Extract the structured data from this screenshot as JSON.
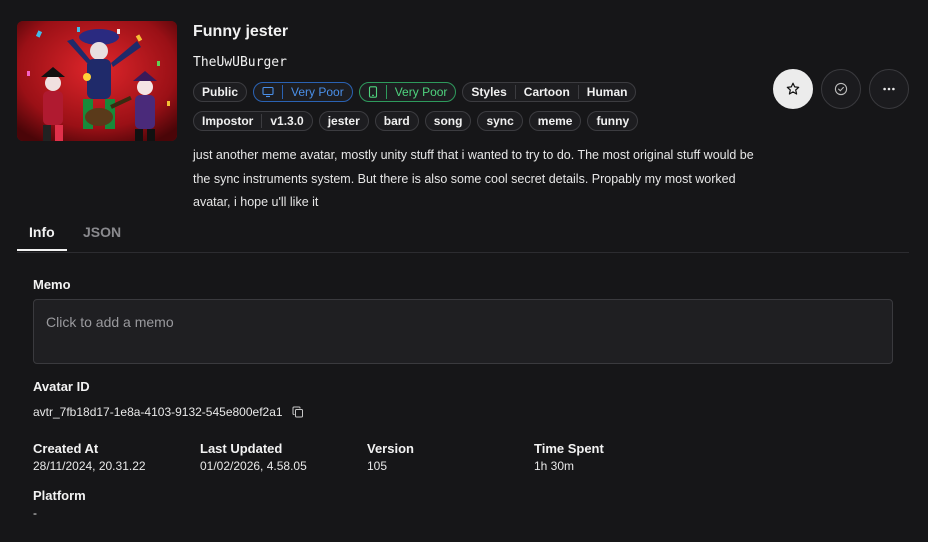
{
  "avatar": {
    "name": "Funny jester",
    "author": "TheUwUBurger",
    "description": "just another meme avatar, mostly unity stuff that i wanted to try to do. The most original stuff would be the sync instruments system. But there is also some cool secret details. Propably my most worked avatar, i hope u'll like it"
  },
  "badges": {
    "visibility": "Public",
    "pc_performance": "Very Poor",
    "quest_performance": "Very Poor",
    "styles_label": "Styles",
    "style_primary": "Cartoon",
    "style_secondary": "Human",
    "impostor_label": "Impostor",
    "impostor_version": "v1.3.0",
    "tags": [
      "jester",
      "bard",
      "song",
      "sync",
      "meme",
      "funny"
    ]
  },
  "colors": {
    "pc": "#4a8fe8",
    "quest": "#4fd37e",
    "background": "#161618"
  },
  "icons": {
    "favorite": "star-icon",
    "check": "circle-check-icon",
    "more": "more-horizontal-icon",
    "pc": "monitor-icon",
    "quest": "phone-icon",
    "copy": "copy-icon"
  },
  "tabs": [
    {
      "label": "Info",
      "active": true
    },
    {
      "label": "JSON",
      "active": false
    }
  ],
  "info": {
    "memo_label": "Memo",
    "memo_placeholder": "Click to add a memo",
    "avatar_id_label": "Avatar ID",
    "avatar_id": "avtr_7fb18d17-1e8a-4103-9132-545e800ef2a1",
    "created_label": "Created At",
    "created_value": "28/11/2024, 20.31.22",
    "updated_label": "Last Updated",
    "updated_value": "01/02/2026, 4.58.05",
    "version_label": "Version",
    "version_value": "105",
    "time_label": "Time Spent",
    "time_value": "1h 30m",
    "platform_label": "Platform",
    "platform_value": "-"
  }
}
